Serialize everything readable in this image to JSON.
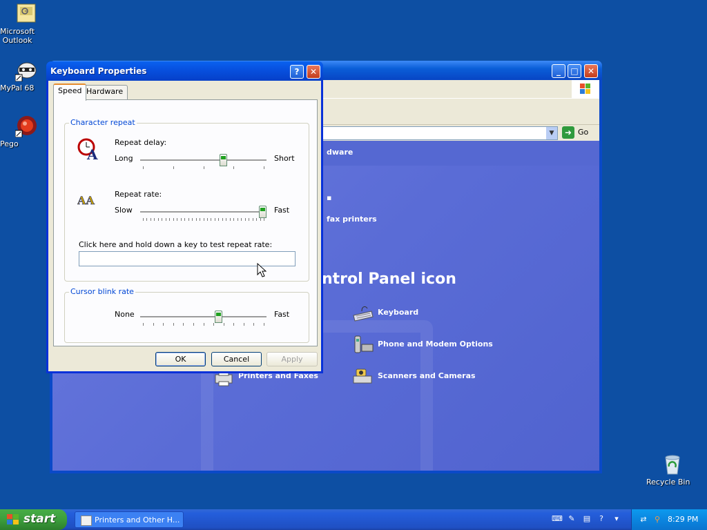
{
  "desktop": {
    "icons": [
      {
        "label_line1": "Microsoft",
        "label_line2": "Outlook",
        "icon": "outlook-icon"
      },
      {
        "label_line1": "MyPal 68",
        "label_line2": "",
        "icon": "mypal-icon"
      },
      {
        "label_line1": "Pego",
        "label_line2": "",
        "icon": "pego-icon"
      },
      {
        "label_line1": "Recycle Bin",
        "label_line2": "",
        "icon": "recycle-bin-icon"
      }
    ]
  },
  "cp_window": {
    "go_label": "Go",
    "partial_texts": {
      "hardware": "dware",
      "fax": "fax printers",
      "pick_icon": "ntrol Panel icon"
    },
    "items": [
      {
        "label": "Keyboard",
        "icon": "keyboard-icon"
      },
      {
        "label": "Phone and Modem Options",
        "icon": "phone-icon"
      },
      {
        "label": "Printers and Faxes",
        "icon": "printer-icon"
      },
      {
        "label": "Scanners and Cameras",
        "icon": "scanner-icon"
      }
    ]
  },
  "dialog": {
    "title": "Keyboard Properties",
    "help_glyph": "?",
    "close_glyph": "✕",
    "tabs": [
      "Speed",
      "Hardware"
    ],
    "active_tab": "Speed",
    "char_repeat": {
      "legend": "Character repeat",
      "delay_label": "Repeat delay:",
      "delay_min": "Long",
      "delay_max": "Short",
      "delay_value": 0.67,
      "rate_label": "Repeat rate:",
      "rate_min": "Slow",
      "rate_max": "Fast",
      "rate_value": 1.0,
      "test_label": "Click here and hold down a key to test repeat rate:",
      "test_value": ""
    },
    "cursor_blink": {
      "legend": "Cursor blink rate",
      "min": "None",
      "max": "Fast",
      "value": 0.63
    },
    "buttons": {
      "ok": "OK",
      "cancel": "Cancel",
      "apply": "Apply"
    }
  },
  "taskbar": {
    "start_label": "start",
    "task": "Printers and Other H...",
    "clock": "8:29 PM"
  },
  "colors": {
    "desktop": "#0d4fa3",
    "titlebar": "#0751e0",
    "dialog_face": "#ece9d8",
    "legend": "#0046d5",
    "start_green": "#3c9d3c"
  }
}
